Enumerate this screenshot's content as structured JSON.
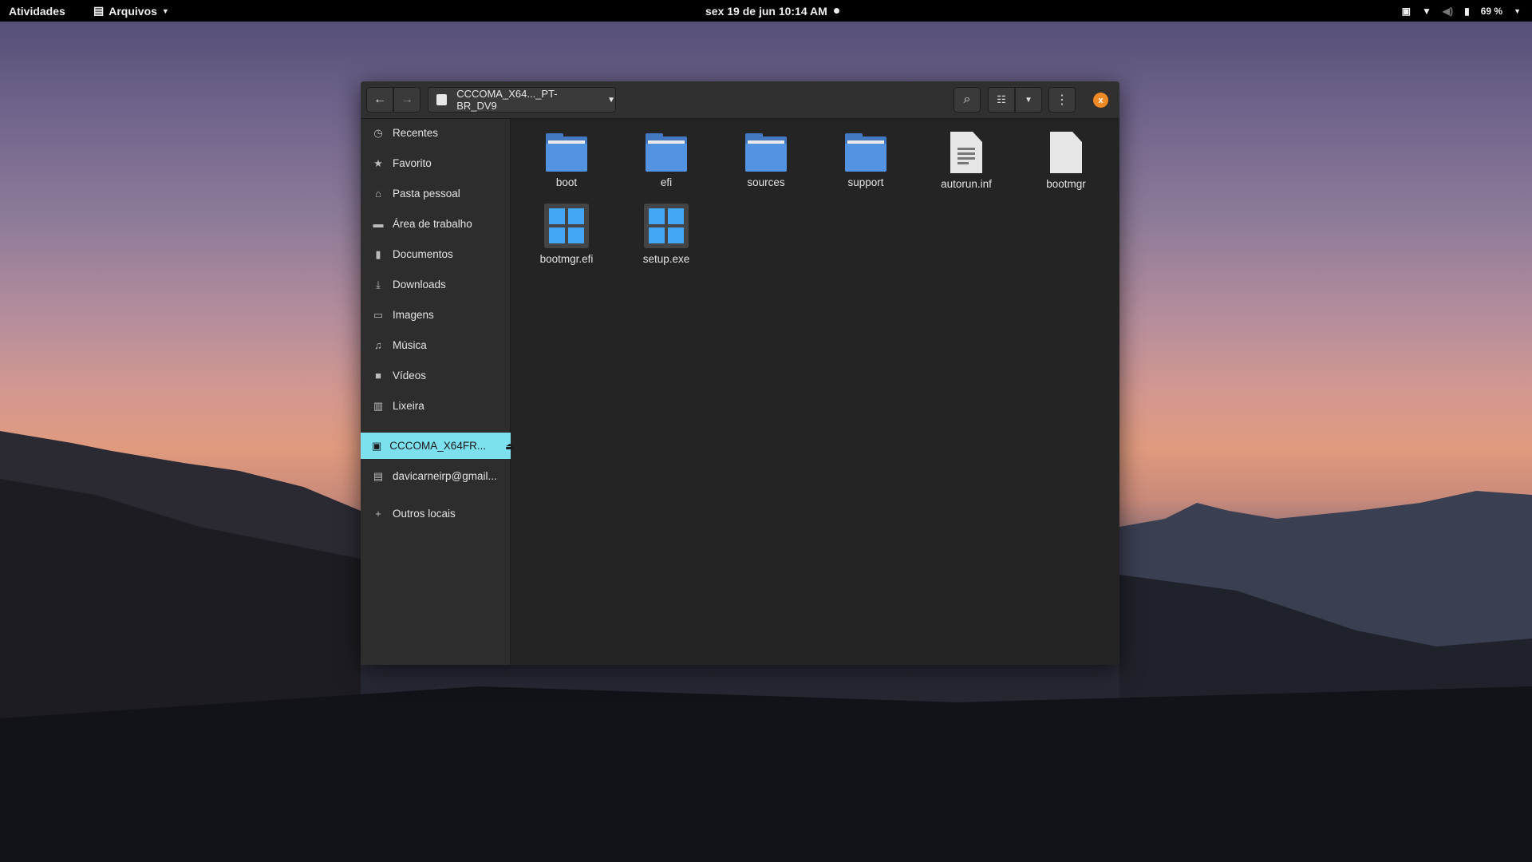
{
  "topbar": {
    "activities": "Atividades",
    "app": "Arquivos",
    "clock": "sex 19 de jun  10:14 AM",
    "battery": "69 %"
  },
  "window": {
    "path": "CCCOMA_X64..._PT-BR_DV9",
    "close_label": "x",
    "sidebar": [
      {
        "label": "Recentes",
        "icon": "clock-icon"
      },
      {
        "label": "Favorito",
        "icon": "star-icon"
      },
      {
        "label": "Pasta pessoal",
        "icon": "home-icon"
      },
      {
        "label": "Área de trabalho",
        "icon": "desktop-icon"
      },
      {
        "label": "Documentos",
        "icon": "document-icon"
      },
      {
        "label": "Downloads",
        "icon": "download-icon"
      },
      {
        "label": "Imagens",
        "icon": "image-icon"
      },
      {
        "label": "Música",
        "icon": "music-icon"
      },
      {
        "label": "Vídeos",
        "icon": "video-icon"
      },
      {
        "label": "Lixeira",
        "icon": "trash-icon"
      },
      {
        "label": "CCCOMA_X64FR...",
        "icon": "drive-icon",
        "selected": true
      },
      {
        "label": "davicarneirp@gmail...",
        "icon": "network-icon"
      },
      {
        "label": "Outros locais",
        "icon": "plus-icon"
      }
    ],
    "files": [
      {
        "name": "boot",
        "type": "folder"
      },
      {
        "name": "efi",
        "type": "folder"
      },
      {
        "name": "sources",
        "type": "folder"
      },
      {
        "name": "support",
        "type": "folder"
      },
      {
        "name": "autorun.inf",
        "type": "text"
      },
      {
        "name": "bootmgr",
        "type": "blank"
      },
      {
        "name": "bootmgr.efi",
        "type": "executable"
      },
      {
        "name": "setup.exe",
        "type": "executable"
      }
    ]
  },
  "colors": {
    "accent": "#7ce0ef",
    "folder": "#5294e2",
    "close": "#f08a24"
  }
}
